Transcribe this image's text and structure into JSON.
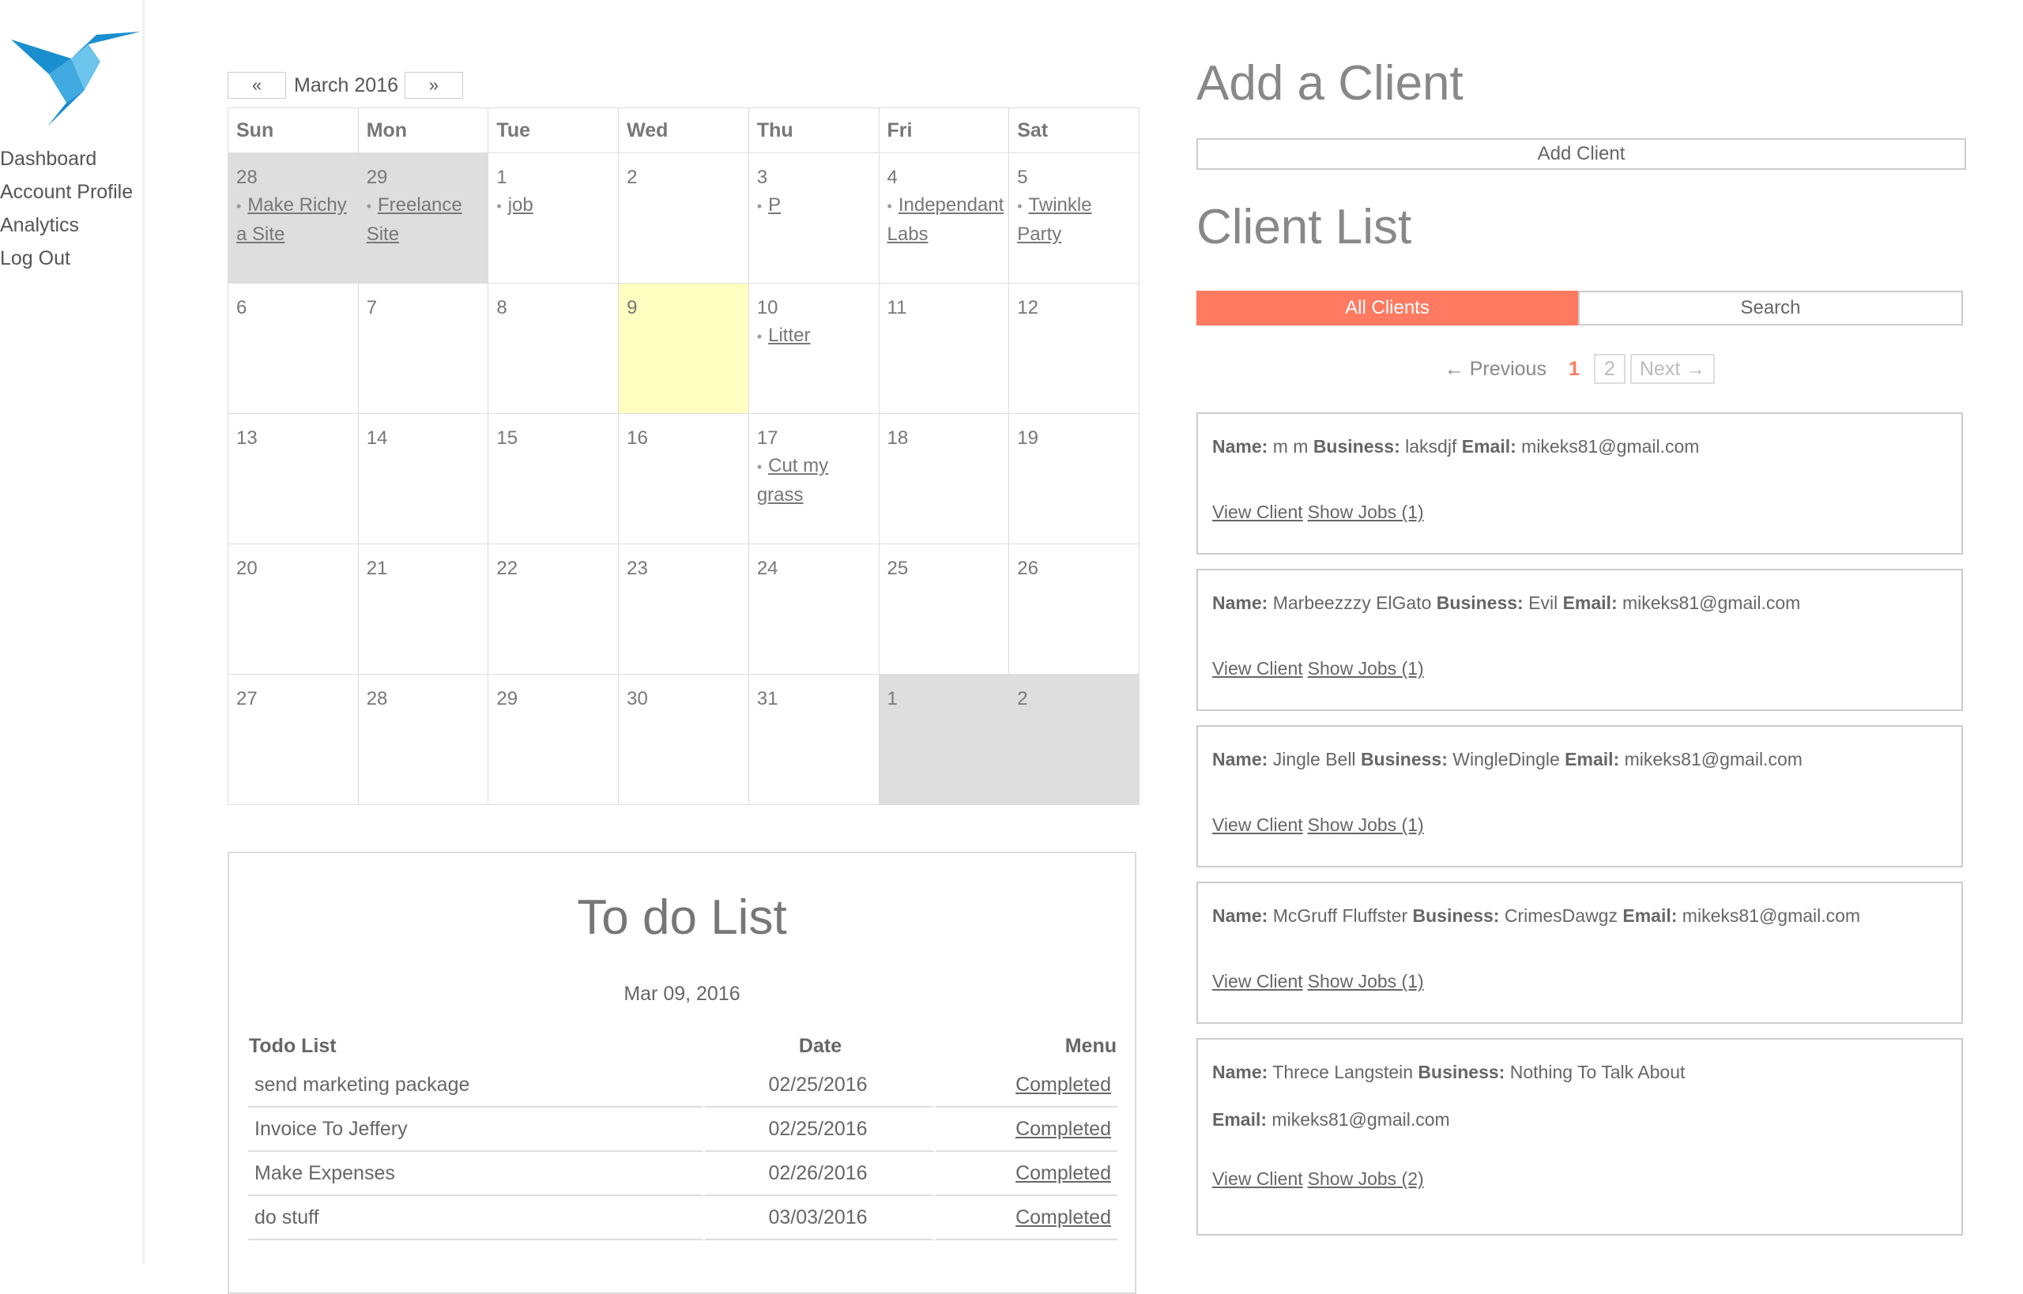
{
  "nav": {
    "items": [
      {
        "label": "Dashboard"
      },
      {
        "label": "Account Profile"
      },
      {
        "label": "Analytics"
      },
      {
        "label": "Log Out"
      }
    ]
  },
  "calendar": {
    "prev_label": "«",
    "next_label": "»",
    "month": "March 2016",
    "weekdays": [
      "Sun",
      "Mon",
      "Tue",
      "Wed",
      "Thu",
      "Fri",
      "Sat"
    ],
    "weeks": [
      [
        {
          "day": "28",
          "off": true,
          "events": [
            "Make Richy a Site"
          ]
        },
        {
          "day": "29",
          "off": true,
          "events": [
            "Freelance Site"
          ]
        },
        {
          "day": "1",
          "events": [
            "job"
          ]
        },
        {
          "day": "2",
          "events": []
        },
        {
          "day": "3",
          "events": [
            "P"
          ]
        },
        {
          "day": "4",
          "events": [
            "Independant Labs"
          ]
        },
        {
          "day": "5",
          "events": [
            "Twinkle Party"
          ]
        }
      ],
      [
        {
          "day": "6",
          "events": []
        },
        {
          "day": "7",
          "events": []
        },
        {
          "day": "8",
          "events": []
        },
        {
          "day": "9",
          "today": true,
          "events": []
        },
        {
          "day": "10",
          "events": [
            "Litter"
          ]
        },
        {
          "day": "11",
          "events": []
        },
        {
          "day": "12",
          "events": []
        }
      ],
      [
        {
          "day": "13",
          "events": []
        },
        {
          "day": "14",
          "events": []
        },
        {
          "day": "15",
          "events": []
        },
        {
          "day": "16",
          "events": []
        },
        {
          "day": "17",
          "events": [
            "Cut my grass"
          ]
        },
        {
          "day": "18",
          "events": []
        },
        {
          "day": "19",
          "events": []
        }
      ],
      [
        {
          "day": "20",
          "events": []
        },
        {
          "day": "21",
          "events": []
        },
        {
          "day": "22",
          "events": []
        },
        {
          "day": "23",
          "events": []
        },
        {
          "day": "24",
          "events": []
        },
        {
          "day": "25",
          "events": []
        },
        {
          "day": "26",
          "events": []
        }
      ],
      [
        {
          "day": "27",
          "events": []
        },
        {
          "day": "28",
          "events": []
        },
        {
          "day": "29",
          "events": []
        },
        {
          "day": "30",
          "events": []
        },
        {
          "day": "31",
          "events": []
        },
        {
          "day": "1",
          "off": true,
          "events": []
        },
        {
          "day": "2",
          "off": true,
          "events": []
        }
      ]
    ]
  },
  "todo": {
    "title": "To do List",
    "date": "Mar 09, 2016",
    "headers": {
      "task": "Todo List",
      "date": "Date",
      "menu": "Menu"
    },
    "rows": [
      {
        "task": "send marketing package",
        "date": "02/25/2016",
        "action": "Completed"
      },
      {
        "task": "Invoice To Jeffery",
        "date": "02/25/2016",
        "action": "Completed"
      },
      {
        "task": "Make Expenses",
        "date": "02/26/2016",
        "action": "Completed"
      },
      {
        "task": "do stuff",
        "date": "03/03/2016",
        "action": "Completed"
      }
    ]
  },
  "add_client": {
    "title": "Add a Client",
    "button_label": "Add Client"
  },
  "client_list": {
    "title": "Client List",
    "tabs": [
      {
        "label": "All Clients",
        "active": true
      },
      {
        "label": "Search",
        "active": false
      }
    ],
    "pager": {
      "prev": "← Previous",
      "current": "1",
      "page2": "2",
      "next": "Next →"
    },
    "labels": {
      "name": "Name:",
      "business": "Business:",
      "email": "Email:"
    },
    "clients": [
      {
        "name": "m m",
        "business": "laksdjf",
        "email": "mikeks81@gmail.com",
        "view": "View Client",
        "jobs": "Show Jobs (1)"
      },
      {
        "name": "Marbeezzzy ElGato",
        "business": "Evil",
        "email": "mikeks81@gmail.com",
        "view": "View Client",
        "jobs": "Show Jobs (1)"
      },
      {
        "name": "Jingle Bell",
        "business": "WingleDingle",
        "email": "mikeks81@gmail.com",
        "view": "View Client",
        "jobs": "Show Jobs (1)"
      },
      {
        "name": "McGruff Fluffster",
        "business": "CrimesDawgz",
        "email": "mikeks81@gmail.com",
        "view": "View Client",
        "jobs": "Show Jobs (1)"
      },
      {
        "name": "Threce Langstein",
        "business": "Nothing To Talk About",
        "email": "mikeks81@gmail.com",
        "view": "View Client",
        "jobs": "Show Jobs (2)",
        "wrap": true
      }
    ]
  },
  "colors": {
    "accent": "#ff7a61",
    "today": "#ffffc2",
    "off_day": "#dedede",
    "logo_dark": "#1a8fd0",
    "logo_light": "#6cc3ec"
  },
  "icons": {
    "logo": "hummingbird-logo-icon"
  }
}
